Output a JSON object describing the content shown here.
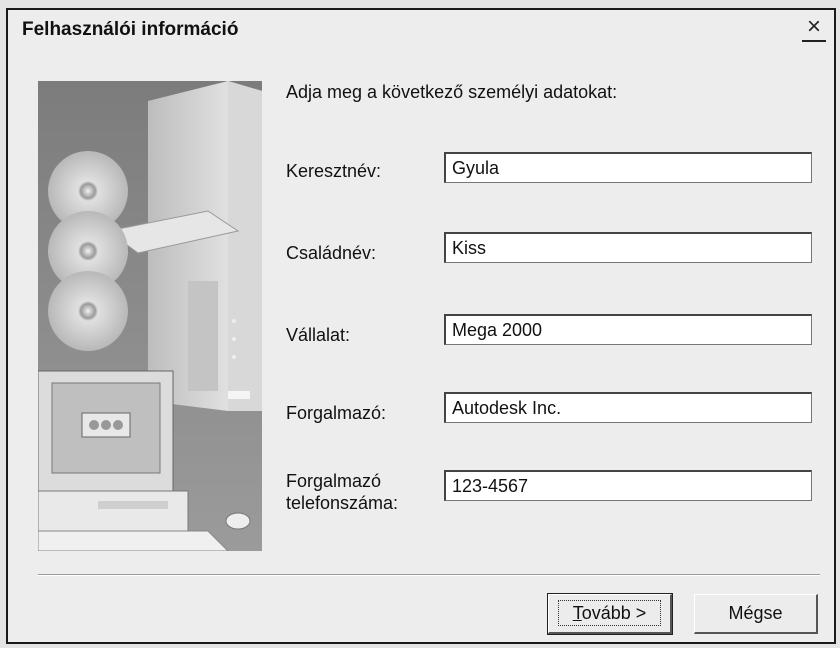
{
  "dialog": {
    "title": "Felhasználói információ",
    "close_symbol": "×",
    "intro": "Adja meg a következő személyi adatokat:",
    "fields": [
      {
        "label": "Keresztnév:",
        "value": "Gyula"
      },
      {
        "label": "Családnév:",
        "value": "Kiss"
      },
      {
        "label": "Vállalat:",
        "value": "Mega 2000"
      },
      {
        "label": "Forgalmazó:",
        "value": "Autodesk Inc."
      },
      {
        "label_line1": "Forgalmazó",
        "label_line2": "telefonszáma:",
        "value": "123-4567"
      }
    ],
    "buttons": {
      "next_mnemonic": "T",
      "next_rest": "ovább >",
      "cancel": "Mégse"
    },
    "art_icon": "computer-with-cds-illustration"
  }
}
